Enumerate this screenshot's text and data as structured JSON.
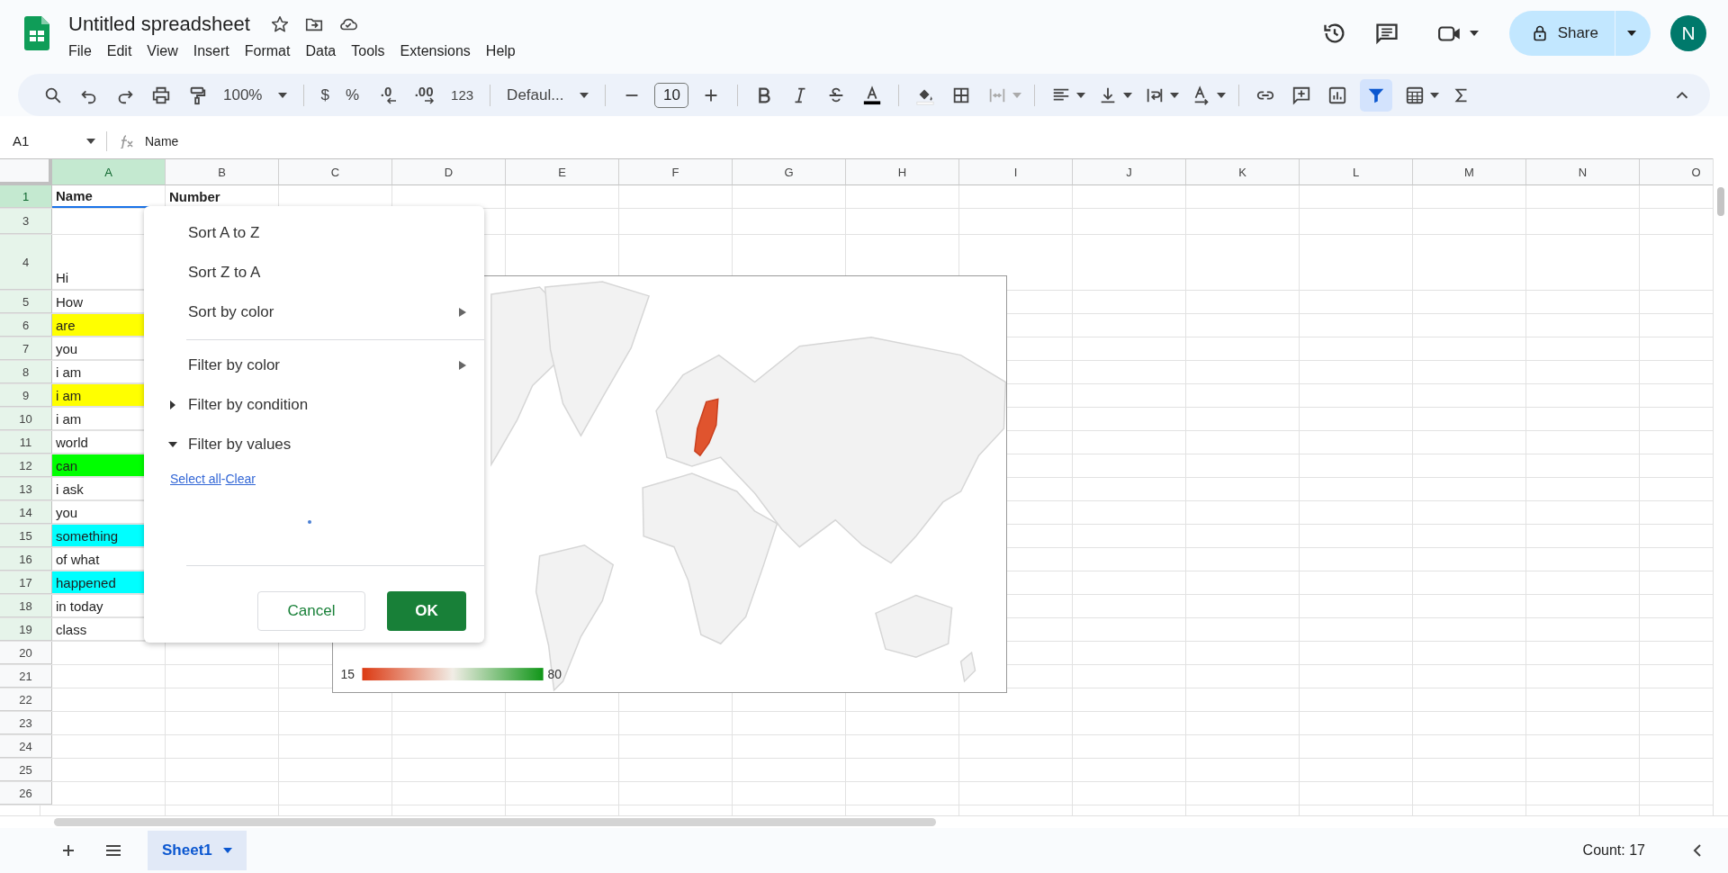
{
  "document": {
    "title": "Untitled spreadsheet"
  },
  "menu_bar": [
    "File",
    "Edit",
    "View",
    "Insert",
    "Format",
    "Data",
    "Tools",
    "Extensions",
    "Help"
  ],
  "share": {
    "label": "Share"
  },
  "account": {
    "initial": "N"
  },
  "toolbar": {
    "zoom": "100%",
    "currency": "$",
    "percent": "%",
    "decrease_decimal": ".0",
    "increase_decimal": ".00",
    "number_format": "123",
    "font": "Defaul...",
    "font_size": "10",
    "merge_disabled": true,
    "filter_selected": true
  },
  "formula_bar": {
    "cell_ref": "A1",
    "content": "Name"
  },
  "columns": [
    {
      "label": "A",
      "selected": true
    },
    {
      "label": "B",
      "selected": false
    },
    {
      "label": "C",
      "selected": false
    },
    {
      "label": "D",
      "selected": false
    },
    {
      "label": "E",
      "selected": false
    },
    {
      "label": "F",
      "selected": false
    },
    {
      "label": "G",
      "selected": false
    },
    {
      "label": "H",
      "selected": false
    },
    {
      "label": "I",
      "selected": false
    },
    {
      "label": "J",
      "selected": false
    },
    {
      "label": "K",
      "selected": false
    },
    {
      "label": "L",
      "selected": false
    },
    {
      "label": "M",
      "selected": false
    },
    {
      "label": "N",
      "selected": false
    },
    {
      "label": "O",
      "selected": false
    }
  ],
  "rows": [
    {
      "number": "1",
      "kind": "header",
      "selected": true,
      "highlighted": true,
      "cells": [
        "Name",
        "Number"
      ]
    },
    {
      "number": "3",
      "kind": "data",
      "selected": false,
      "highlighted": true,
      "cells": []
    },
    {
      "number": "4",
      "kind": "tall",
      "selected": false,
      "highlighted": true,
      "cells": [
        "Hi"
      ]
    },
    {
      "number": "5",
      "kind": "data",
      "selected": false,
      "highlighted": true,
      "cells": [
        "How"
      ]
    },
    {
      "number": "6",
      "kind": "data",
      "selected": false,
      "highlighted": true,
      "cells": [
        "are"
      ],
      "color": "#ffff00"
    },
    {
      "number": "7",
      "kind": "data",
      "selected": false,
      "highlighted": true,
      "cells": [
        "you"
      ]
    },
    {
      "number": "8",
      "kind": "data",
      "selected": false,
      "highlighted": true,
      "cells": [
        "i am"
      ]
    },
    {
      "number": "9",
      "kind": "data",
      "selected": false,
      "highlighted": true,
      "cells": [
        "i am"
      ],
      "color": "#ffff00"
    },
    {
      "number": "10",
      "kind": "data",
      "selected": false,
      "highlighted": true,
      "cells": [
        "i am"
      ]
    },
    {
      "number": "11",
      "kind": "data",
      "selected": false,
      "highlighted": true,
      "cells": [
        "world"
      ]
    },
    {
      "number": "12",
      "kind": "data",
      "selected": false,
      "highlighted": true,
      "cells": [
        "can"
      ],
      "color": "#00ff00"
    },
    {
      "number": "13",
      "kind": "data",
      "selected": false,
      "highlighted": true,
      "cells": [
        "i ask"
      ]
    },
    {
      "number": "14",
      "kind": "data",
      "selected": false,
      "highlighted": true,
      "cells": [
        "you"
      ]
    },
    {
      "number": "15",
      "kind": "data",
      "selected": false,
      "highlighted": true,
      "cells": [
        "something"
      ],
      "color": "#00ffff"
    },
    {
      "number": "16",
      "kind": "data",
      "selected": false,
      "highlighted": true,
      "cells": [
        "of what"
      ]
    },
    {
      "number": "17",
      "kind": "data",
      "selected": false,
      "highlighted": true,
      "cells": [
        "happened"
      ],
      "color": "#00ffff"
    },
    {
      "number": "18",
      "kind": "data",
      "selected": false,
      "highlighted": true,
      "cells": [
        "in today"
      ]
    },
    {
      "number": "19",
      "kind": "data",
      "selected": false,
      "highlighted": true,
      "cells": [
        "class"
      ]
    },
    {
      "number": "20",
      "kind": "data",
      "selected": false,
      "highlighted": false,
      "cells": []
    },
    {
      "number": "21",
      "kind": "data",
      "selected": false,
      "highlighted": false,
      "cells": []
    },
    {
      "number": "22",
      "kind": "data",
      "selected": false,
      "highlighted": false,
      "cells": []
    },
    {
      "number": "23",
      "kind": "data",
      "selected": false,
      "highlighted": false,
      "cells": []
    },
    {
      "number": "24",
      "kind": "data",
      "selected": false,
      "highlighted": false,
      "cells": []
    },
    {
      "number": "25",
      "kind": "data",
      "selected": false,
      "highlighted": false,
      "cells": []
    },
    {
      "number": "26",
      "kind": "data",
      "selected": false,
      "highlighted": false,
      "cells": []
    }
  ],
  "chart": {
    "legend_min": "15",
    "legend_max": "80"
  },
  "filter_menu": {
    "sort_items": [
      {
        "kind": "action",
        "label": "Sort A to Z"
      },
      {
        "kind": "action",
        "label": "Sort Z to A"
      },
      {
        "kind": "submenu",
        "label": "Sort by color"
      }
    ],
    "filter_items": [
      {
        "kind": "submenu",
        "label": "Filter by color"
      },
      {
        "kind": "collapsible",
        "label": "Filter by condition",
        "expanded": false
      },
      {
        "kind": "collapsible",
        "label": "Filter by values",
        "expanded": true
      }
    ],
    "links": [
      "Select all",
      "Clear"
    ],
    "link_separator": "-",
    "loading": true,
    "buttons": [
      {
        "label": "Cancel",
        "primary": false
      },
      {
        "label": "OK",
        "primary": true
      }
    ]
  },
  "sheets": [
    {
      "name": "Sheet1",
      "selected": true
    }
  ],
  "status": {
    "summary": "Count: 17"
  }
}
